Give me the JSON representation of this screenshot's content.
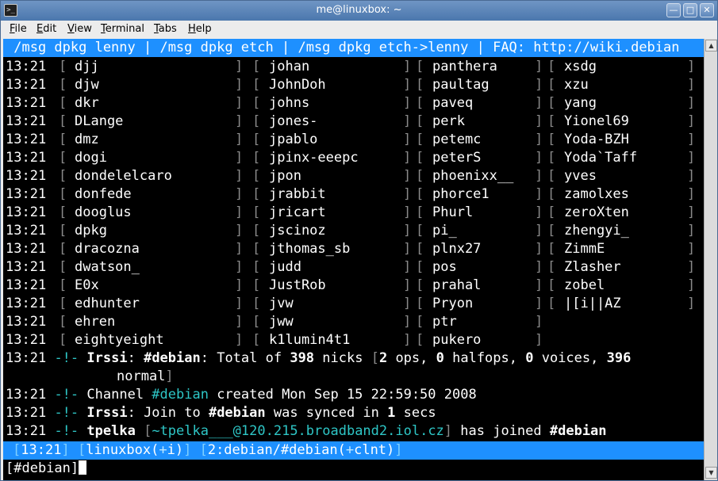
{
  "window": {
    "title": "me@linuxbox: ~"
  },
  "menu": [
    {
      "label": "File",
      "u": "F",
      "rest": "ile"
    },
    {
      "label": "Edit",
      "u": "E",
      "rest": "dit"
    },
    {
      "label": "View",
      "u": "V",
      "rest": "iew"
    },
    {
      "label": "Terminal",
      "u": "T",
      "rest": "erminal"
    },
    {
      "label": "Tabs",
      "u": "T",
      "rest": "abs"
    },
    {
      "label": "Help",
      "u": "H",
      "rest": "elp"
    }
  ],
  "topic": " /msg dpkg lenny | /msg dpkg etch | /msg dpkg etch->lenny | FAQ: http://wiki.debian",
  "names_time": "13:21",
  "names": [
    [
      "djj",
      "johan",
      "panthera",
      "xsdg"
    ],
    [
      "djw",
      "JohnDoh",
      "paultag",
      "xzu"
    ],
    [
      "dkr",
      "johns",
      "paveq",
      "yang"
    ],
    [
      "DLange",
      "jones-",
      "perk",
      "Yionel69"
    ],
    [
      "dmz",
      "jpablo",
      "petemc",
      "Yoda-BZH"
    ],
    [
      "dogi",
      "jpinx-eeepc",
      "peterS",
      "Yoda`Taff"
    ],
    [
      "dondelelcaro",
      "jpon",
      "phoenixx__",
      "yves"
    ],
    [
      "donfede",
      "jrabbit",
      "phorce1",
      "zamolxes"
    ],
    [
      "dooglus",
      "jricart",
      "Phurl",
      "zeroXten"
    ],
    [
      "dpkg",
      "jscinoz",
      "pi_",
      "zhengyi_"
    ],
    [
      "dracozna",
      "jthomas_sb",
      "plnx27",
      "ZimmE"
    ],
    [
      "dwatson_",
      "judd",
      "pos",
      "Zlasher"
    ],
    [
      "E0x",
      "JustRob",
      "prahal",
      "zobel"
    ],
    [
      "edhunter",
      "jvw",
      "Pryon",
      "|[i||AZ"
    ],
    [
      "ehren",
      "jww",
      "ptr",
      ""
    ],
    [
      "eightyeight",
      "k1lumin4t1",
      "pukero",
      ""
    ]
  ],
  "messages": {
    "total": {
      "time": "13:21",
      "marker": "-!-",
      "irssi": "Irssi",
      "channel": "#debian",
      "p1": ": Total of ",
      "total": "398",
      "p2": " nicks ",
      "ops": "2",
      "p3": " ops, ",
      "halfops": "0",
      "p4": " halfops, ",
      "voices": "0",
      "p5": " voices, ",
      "normal": "396",
      "p6": "normal"
    },
    "created": {
      "time": "13:21",
      "marker": "-!-",
      "p1": "Channel ",
      "channel": "#debian",
      "p2": " created Mon Sep 15 22:59:50 2008"
    },
    "synced": {
      "time": "13:21",
      "marker": "-!-",
      "irssi": "Irssi",
      "p1": ": Join to ",
      "channel": "#debian",
      "p2": " was synced in ",
      "secs": "1",
      "p3": " secs"
    },
    "joined": {
      "time": "13:21",
      "marker": "-!-",
      "nick": "tpelka",
      "host": "~tpelka___@120.215.broadband2.iol.cz",
      "p1": " has joined ",
      "channel": "#debian"
    }
  },
  "status": {
    "time": "13:21",
    "host": "linuxbox",
    "umode": "i",
    "window": "2:debian/#debian",
    "cmode": "clnt"
  },
  "prompt": "[#debian]"
}
